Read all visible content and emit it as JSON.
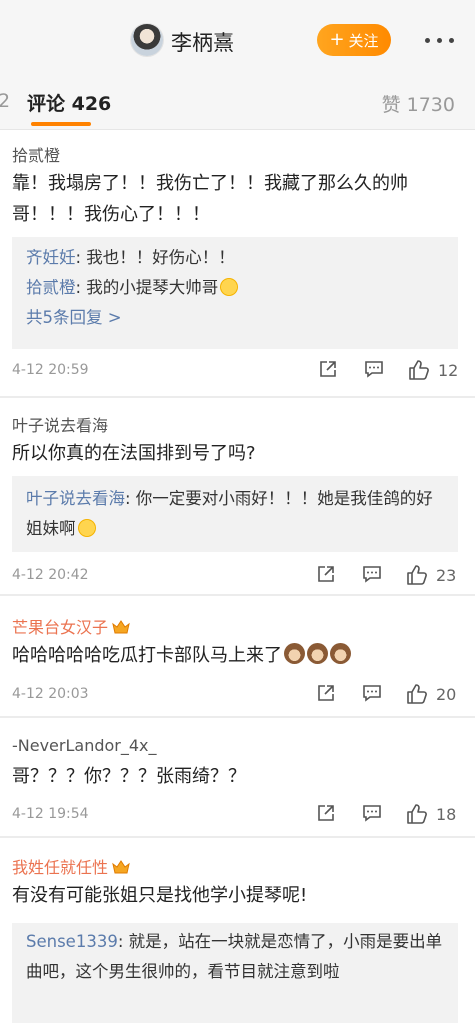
{
  "header": {
    "username": "李柄熹",
    "follow_label": "关注",
    "follow_plus": "+"
  },
  "tabs": {
    "prev_fragment": "2",
    "comments_label": "评论 426",
    "likes_label": "赞 1730"
  },
  "comments": [
    {
      "author": "拾贰橙",
      "text": "靠！我塌房了！！我伤亡了！！我藏了那么久的帅哥！！！我伤心了！！！",
      "replies": [
        {
          "name": "齐妊妊",
          "text": ": 我也！！好伤心！！"
        },
        {
          "name": "拾贰橙",
          "text": ": 我的小提琴大帅哥"
        }
      ],
      "more_replies": "共5条回复 >",
      "time": "4-12 20:59",
      "likes": "12"
    },
    {
      "author": "叶子说去看海",
      "text": "所以你真的在法国排到号了吗?",
      "replies": [
        {
          "name": "叶子说去看海",
          "text": ": 你一定要对小雨好！！！她是我佳鸽的好姐妹啊"
        }
      ],
      "time": "4-12 20:42",
      "likes": "23"
    },
    {
      "author": "芒果台女汉子",
      "text": "哈哈哈哈哈吃瓜打卡部队马上来了",
      "time": "4-12 20:03",
      "likes": "20"
    },
    {
      "author": "-NeverLandor_4x_",
      "text": "哥？？？你？？？张雨绮？？",
      "time": "4-12 19:54",
      "likes": "18"
    },
    {
      "author": "我姓任就任性",
      "text": "有没有可能张姐只是找他学小提琴呢!",
      "replies": [
        {
          "name": "Sense1339",
          "text": ": 就是，站在一块就是恋情了，小雨是要出单曲吧，这个男生很帅的，看节目就注意到啦"
        }
      ]
    }
  ],
  "colors": {
    "accent": "#ff8200",
    "link": "#5b7bab",
    "vip_name": "#eb7350"
  }
}
